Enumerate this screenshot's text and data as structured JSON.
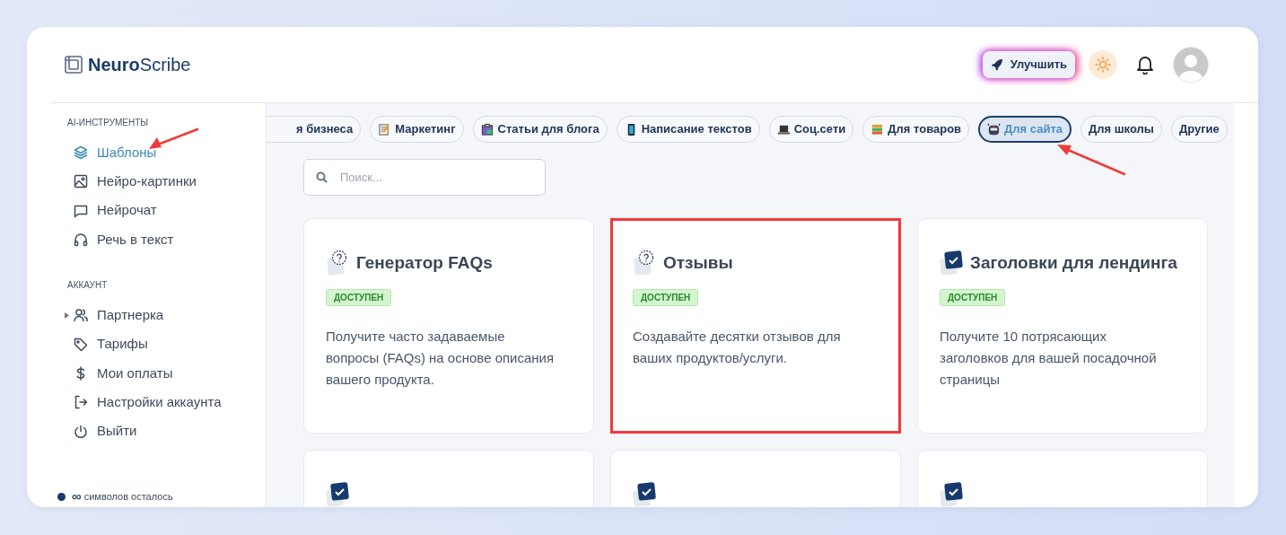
{
  "logo": {
    "bold": "Neuro",
    "light": "Scribe"
  },
  "header": {
    "upgrade": "Улучшить"
  },
  "sidebar": {
    "sections": [
      {
        "title": "AI-ИНСТРУМЕНТЫ",
        "items": [
          {
            "label": "Шаблоны",
            "selected": true,
            "pointed": true
          },
          {
            "label": "Нейро-картинки",
            "selected": false,
            "pointed": false
          },
          {
            "label": "Нейрочат",
            "selected": false,
            "pointed": false
          },
          {
            "label": "Речь в текст",
            "selected": false,
            "pointed": false
          }
        ]
      },
      {
        "title": "АККАУНТ",
        "items": [
          {
            "label": "Партнерка",
            "selected": false,
            "pointed": false,
            "expanded": false
          },
          {
            "label": "Тарифы",
            "selected": false,
            "pointed": false
          },
          {
            "label": "Мои оплаты",
            "selected": false,
            "pointed": false
          },
          {
            "label": "Настройки аккаунта",
            "selected": false,
            "pointed": false
          },
          {
            "label": "Выйти",
            "selected": false,
            "pointed": false
          }
        ]
      }
    ],
    "footer": {
      "symbol": "∞",
      "text": "символов осталось"
    }
  },
  "categories": [
    {
      "label": "я бизнеса",
      "selected": false,
      "pointed": false
    },
    {
      "label": "Маркетинг",
      "selected": false,
      "pointed": false
    },
    {
      "label": "Статьи для блога",
      "selected": false,
      "pointed": false
    },
    {
      "label": "Написание текстов",
      "selected": false,
      "pointed": false
    },
    {
      "label": "Соц.сети",
      "selected": false,
      "pointed": false
    },
    {
      "label": "Для товаров",
      "selected": false,
      "pointed": false
    },
    {
      "label": "Для сайта",
      "selected": true,
      "pointed": true
    },
    {
      "label": "Для школы",
      "selected": false,
      "pointed": false
    },
    {
      "label": "Другие",
      "selected": false,
      "pointed": false
    }
  ],
  "search": {
    "placeholder": "Поиск..."
  },
  "cards": [
    {
      "kind": "faq",
      "title": "Генератор FAQs",
      "status": "ДОСТУПЕН",
      "description": "Получите часто задаваемые вопросы (FAQs) на основе описания вашего продукта.",
      "highlighted": false
    },
    {
      "kind": "faq",
      "title": "Отзывы",
      "status": "ДОСТУПЕН",
      "description": "Создавайте десятки отзывов для ваших продуктов/услуги.",
      "highlighted": true
    },
    {
      "kind": "check",
      "title": "Заголовки для лендинга",
      "status": "ДОСТУПЕН",
      "description": "Получите 10 потрясающих заголовков для вашей посадочной страницы",
      "highlighted": false
    },
    {
      "kind": "check",
      "highlighted": false
    },
    {
      "kind": "check",
      "highlighted": false
    },
    {
      "kind": "check",
      "highlighted": false
    }
  ]
}
